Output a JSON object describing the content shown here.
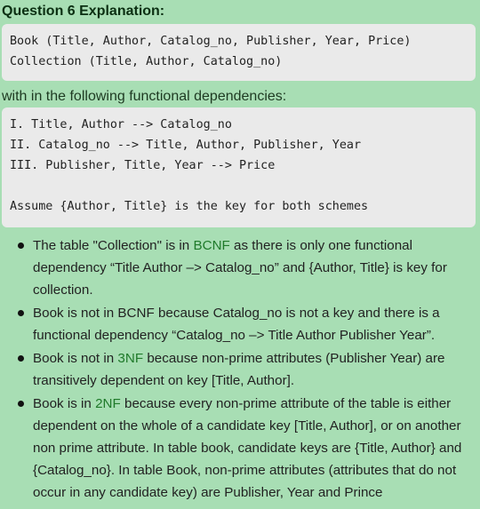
{
  "title": "Question 6 Explanation:",
  "schema_lines": [
    "Book (Title, Author, Catalog_no, Publisher, Year, Price)",
    "Collection (Title, Author, Catalog_no)"
  ],
  "intro": "with in the following functional dependencies:",
  "fd_lines": [
    "I. Title, Author --> Catalog_no",
    "II. Catalog_no --> Title, Author, Publisher, Year",
    "III. Publisher, Title, Year --> Price",
    "",
    "Assume {Author, Title} is the key for both schemes"
  ],
  "bullets": [
    {
      "before": "The table \"Collection\" is in ",
      "highlight": "BCNF",
      "after": " as there is only one functional dependency “Title Author –> Catalog_no” and {Author, Title} is key for collection."
    },
    {
      "before": "Book is not in BCNF because Catalog_no is not a key and there is a functional dependency “Catalog_no –> Title Author Publisher Year”.",
      "highlight": "",
      "after": ""
    },
    {
      "before": "Book is not in ",
      "highlight": "3NF",
      "after": " because non-prime attributes (Publisher Year) are transitively dependent on key [Title, Author]."
    },
    {
      "before": "Book is in ",
      "highlight": "2NF",
      "after": " because every non-prime attribute of the table is either dependent on the whole of a candidate key [Title, Author], or on another non prime attribute. In table book, candidate keys are {Title, Author} and {Catalog_no}. In table Book, non-prime attributes (attributes that do not occur in any candidate key) are Publisher, Year and Prince"
    }
  ],
  "colors": {
    "background": "#a8deb4",
    "highlight": "#1f7a2a",
    "code_background": "#eaeaea"
  }
}
